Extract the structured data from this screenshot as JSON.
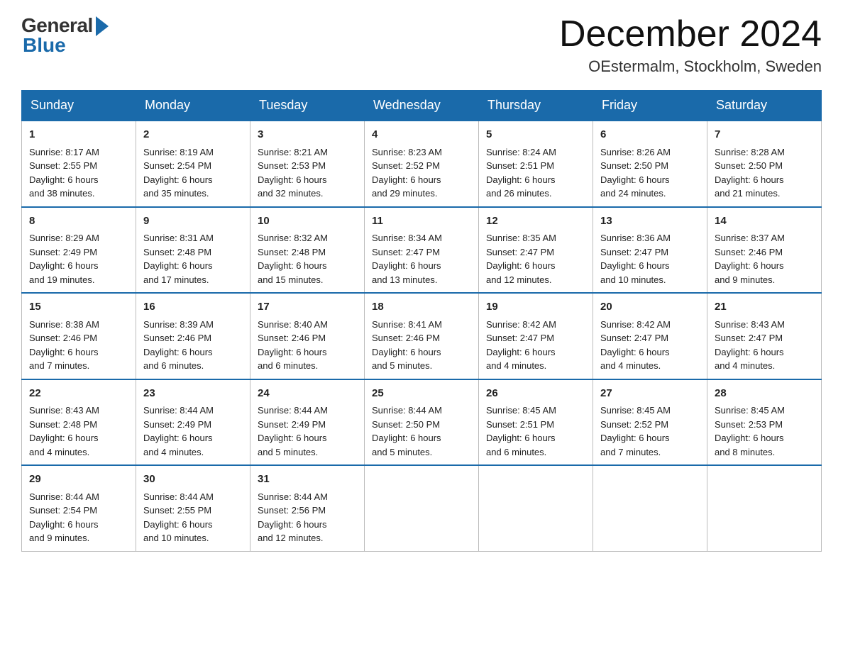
{
  "logo": {
    "general": "General",
    "blue": "Blue"
  },
  "title": "December 2024",
  "location": "OEstermalm, Stockholm, Sweden",
  "weekdays": [
    "Sunday",
    "Monday",
    "Tuesday",
    "Wednesday",
    "Thursday",
    "Friday",
    "Saturday"
  ],
  "weeks": [
    [
      {
        "day": "1",
        "sunrise": "8:17 AM",
        "sunset": "2:55 PM",
        "daylight": "6 hours and 38 minutes."
      },
      {
        "day": "2",
        "sunrise": "8:19 AM",
        "sunset": "2:54 PM",
        "daylight": "6 hours and 35 minutes."
      },
      {
        "day": "3",
        "sunrise": "8:21 AM",
        "sunset": "2:53 PM",
        "daylight": "6 hours and 32 minutes."
      },
      {
        "day": "4",
        "sunrise": "8:23 AM",
        "sunset": "2:52 PM",
        "daylight": "6 hours and 29 minutes."
      },
      {
        "day": "5",
        "sunrise": "8:24 AM",
        "sunset": "2:51 PM",
        "daylight": "6 hours and 26 minutes."
      },
      {
        "day": "6",
        "sunrise": "8:26 AM",
        "sunset": "2:50 PM",
        "daylight": "6 hours and 24 minutes."
      },
      {
        "day": "7",
        "sunrise": "8:28 AM",
        "sunset": "2:50 PM",
        "daylight": "6 hours and 21 minutes."
      }
    ],
    [
      {
        "day": "8",
        "sunrise": "8:29 AM",
        "sunset": "2:49 PM",
        "daylight": "6 hours and 19 minutes."
      },
      {
        "day": "9",
        "sunrise": "8:31 AM",
        "sunset": "2:48 PM",
        "daylight": "6 hours and 17 minutes."
      },
      {
        "day": "10",
        "sunrise": "8:32 AM",
        "sunset": "2:48 PM",
        "daylight": "6 hours and 15 minutes."
      },
      {
        "day": "11",
        "sunrise": "8:34 AM",
        "sunset": "2:47 PM",
        "daylight": "6 hours and 13 minutes."
      },
      {
        "day": "12",
        "sunrise": "8:35 AM",
        "sunset": "2:47 PM",
        "daylight": "6 hours and 12 minutes."
      },
      {
        "day": "13",
        "sunrise": "8:36 AM",
        "sunset": "2:47 PM",
        "daylight": "6 hours and 10 minutes."
      },
      {
        "day": "14",
        "sunrise": "8:37 AM",
        "sunset": "2:46 PM",
        "daylight": "6 hours and 9 minutes."
      }
    ],
    [
      {
        "day": "15",
        "sunrise": "8:38 AM",
        "sunset": "2:46 PM",
        "daylight": "6 hours and 7 minutes."
      },
      {
        "day": "16",
        "sunrise": "8:39 AM",
        "sunset": "2:46 PM",
        "daylight": "6 hours and 6 minutes."
      },
      {
        "day": "17",
        "sunrise": "8:40 AM",
        "sunset": "2:46 PM",
        "daylight": "6 hours and 6 minutes."
      },
      {
        "day": "18",
        "sunrise": "8:41 AM",
        "sunset": "2:46 PM",
        "daylight": "6 hours and 5 minutes."
      },
      {
        "day": "19",
        "sunrise": "8:42 AM",
        "sunset": "2:47 PM",
        "daylight": "6 hours and 4 minutes."
      },
      {
        "day": "20",
        "sunrise": "8:42 AM",
        "sunset": "2:47 PM",
        "daylight": "6 hours and 4 minutes."
      },
      {
        "day": "21",
        "sunrise": "8:43 AM",
        "sunset": "2:47 PM",
        "daylight": "6 hours and 4 minutes."
      }
    ],
    [
      {
        "day": "22",
        "sunrise": "8:43 AM",
        "sunset": "2:48 PM",
        "daylight": "6 hours and 4 minutes."
      },
      {
        "day": "23",
        "sunrise": "8:44 AM",
        "sunset": "2:49 PM",
        "daylight": "6 hours and 4 minutes."
      },
      {
        "day": "24",
        "sunrise": "8:44 AM",
        "sunset": "2:49 PM",
        "daylight": "6 hours and 5 minutes."
      },
      {
        "day": "25",
        "sunrise": "8:44 AM",
        "sunset": "2:50 PM",
        "daylight": "6 hours and 5 minutes."
      },
      {
        "day": "26",
        "sunrise": "8:45 AM",
        "sunset": "2:51 PM",
        "daylight": "6 hours and 6 minutes."
      },
      {
        "day": "27",
        "sunrise": "8:45 AM",
        "sunset": "2:52 PM",
        "daylight": "6 hours and 7 minutes."
      },
      {
        "day": "28",
        "sunrise": "8:45 AM",
        "sunset": "2:53 PM",
        "daylight": "6 hours and 8 minutes."
      }
    ],
    [
      {
        "day": "29",
        "sunrise": "8:44 AM",
        "sunset": "2:54 PM",
        "daylight": "6 hours and 9 minutes."
      },
      {
        "day": "30",
        "sunrise": "8:44 AM",
        "sunset": "2:55 PM",
        "daylight": "6 hours and 10 minutes."
      },
      {
        "day": "31",
        "sunrise": "8:44 AM",
        "sunset": "2:56 PM",
        "daylight": "6 hours and 12 minutes."
      },
      null,
      null,
      null,
      null
    ]
  ]
}
